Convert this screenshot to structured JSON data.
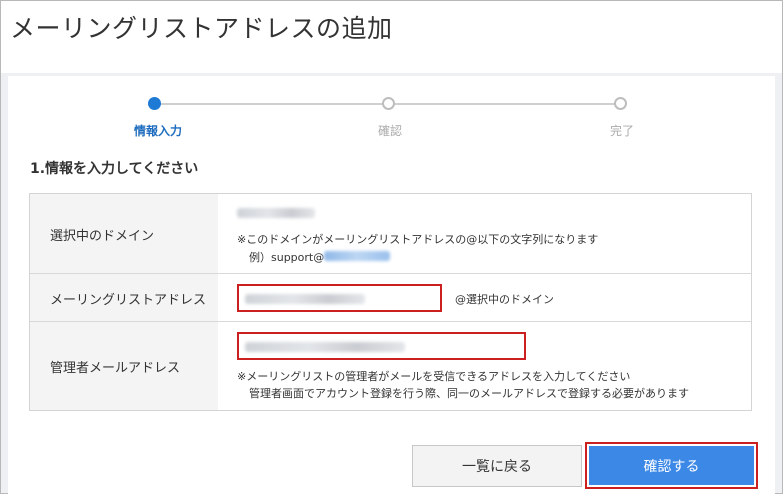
{
  "page": {
    "title": "メーリングリストアドレスの追加"
  },
  "stepper": {
    "steps": [
      {
        "label": "情報入力",
        "state": "active"
      },
      {
        "label": "確認",
        "state": "inactive"
      },
      {
        "label": "完了",
        "state": "inactive"
      }
    ],
    "active_color": "#1f7ad6"
  },
  "section": {
    "title": "1.情報を入力してください"
  },
  "form": {
    "domain_row": {
      "label": "選択中のドメイン",
      "note_line1": "※このドメインがメーリングリストアドレスの@以下の文字列になります",
      "note_line2_prefix": "例）support@"
    },
    "address_row": {
      "label": "メーリングリストアドレス",
      "suffix": "@選択中のドメイン"
    },
    "admin_row": {
      "label": "管理者メールアドレス",
      "note_line1": "※メーリングリストの管理者がメールを受信できるアドレスを入力してください",
      "note_line2": "管理者画面でアカウント登録を行う際、同一のメールアドレスで登録する必要があります"
    }
  },
  "actions": {
    "back_label": "一覧に戻る",
    "confirm_label": "確認する"
  },
  "colors": {
    "accent": "#3b88e6",
    "highlight_border": "#cc1f1f",
    "background": "#eef0f4"
  }
}
